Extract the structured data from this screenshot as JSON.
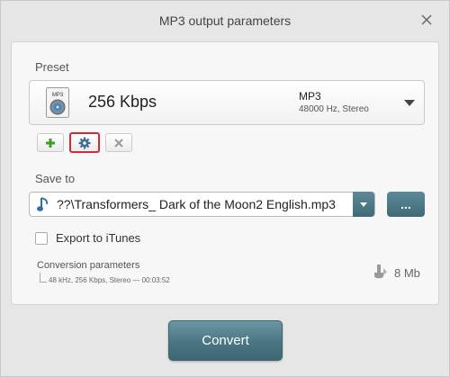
{
  "window": {
    "title": "MP3 output parameters"
  },
  "preset": {
    "label": "Preset",
    "bitrate": "256 Kbps",
    "format": "MP3",
    "details": "48000 Hz,  Stereo",
    "icon_text": "MP3"
  },
  "buttons": {
    "add": "add-icon",
    "settings": "gear-icon",
    "remove": "close-icon"
  },
  "save_to": {
    "label": "Save to",
    "path": "??\\Transformers_ Dark of the Moon2 English.mp3",
    "browse": "..."
  },
  "itunes": {
    "label": "Export to iTunes",
    "checked": false
  },
  "conversion": {
    "label": "Conversion parameters",
    "details": "48 kHz, 256 Kbps, Stereo — 00:03:52",
    "size": "8 Mb"
  },
  "convert": {
    "label": "Convert"
  },
  "colors": {
    "accent": "#4b7582",
    "add_green": "#3f9b2a",
    "selected_border": "#d42a35"
  }
}
